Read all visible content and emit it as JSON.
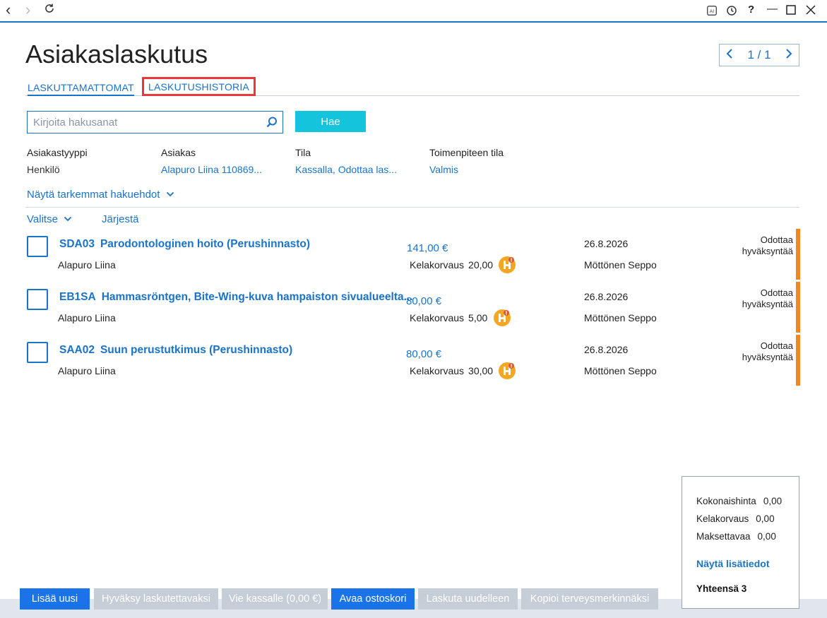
{
  "window": {
    "back_glyph": "‹",
    "forward_glyph": "›",
    "reload_glyph": "⟳",
    "icons": [
      "ai-icon",
      "history-icon",
      "help-icon",
      "minimize-icon",
      "maximize-icon",
      "close-icon"
    ],
    "help_glyph": "?",
    "minimize_glyph": "—",
    "maximize_glyph": "☐",
    "close_glyph": "✕"
  },
  "page": {
    "title": "Asiakaslaskutus",
    "pager": {
      "text": "1 / 1"
    }
  },
  "tabs": [
    {
      "label": "LASKUTTAMATTOMAT",
      "active": true
    },
    {
      "label": "LASKUTUSHISTORIA",
      "active": false,
      "highlighted": true
    }
  ],
  "search": {
    "placeholder": "Kirjoita hakusanat",
    "button_label": "Hae"
  },
  "filters": [
    {
      "label": "Asiakastyyppi",
      "value": "Henkilö",
      "is_link": false
    },
    {
      "label": "Asiakas",
      "value": "Alapuro Liina 110869...",
      "is_link": true
    },
    {
      "label": "Tila",
      "value": "Kassalla, Odottaa las...",
      "is_link": true
    },
    {
      "label": "Toimenpiteen tila",
      "value": "Valmis",
      "is_link": true
    }
  ],
  "more_filters": "Näytä tarkemmat hakuehdot",
  "list_actions": {
    "select": "Valitse",
    "sort": "Järjestä"
  },
  "rows": [
    {
      "code": "SDA03",
      "name": "Parodontologinen hoito (Perushinnasto)",
      "customer": "Alapuro Liina",
      "price": "141,00 €",
      "kela_label": "Kelakorvaus",
      "kela_value": "20,00",
      "date": "26.8.2026",
      "person": "Möttönen Seppo",
      "status_line1": "Odottaa",
      "status_line2": "hyväksyntää"
    },
    {
      "code": "EB1SA",
      "name": "Hammasröntgen, Bite-Wing-kuva hampaiston sivualueelta...",
      "customer": "Alapuro Liina",
      "price": "80,00 €",
      "kela_label": "Kelakorvaus",
      "kela_value": "5,00",
      "date": "26.8.2026",
      "person": "Möttönen Seppo",
      "status_line1": "Odottaa",
      "status_line2": "hyväksyntää"
    },
    {
      "code": "SAA02",
      "name": "Suun perustutkimus (Perushinnasto)",
      "customer": "Alapuro Liina",
      "price": "80,00 €",
      "kela_label": "Kelakorvaus",
      "kela_value": "30,00",
      "date": "26.8.2026",
      "person": "Möttönen Seppo",
      "status_line1": "Odottaa",
      "status_line2": "hyväksyntää"
    }
  ],
  "summary": {
    "total_price_label": "Kokonaishinta",
    "total_price": "0,00",
    "kela_label": "Kelakorvaus",
    "kela": "0,00",
    "payable_label": "Maksettavaa",
    "payable": "0,00",
    "details_link": "Näytä lisätiedot",
    "count_label": "Yhteensä 3"
  },
  "actions": {
    "add_new": "Lisää uusi",
    "approve": "Hyväksy laskutettavaksi",
    "to_checkout": "Vie kassalle (0,00 €)",
    "open_cart": "Avaa ostoskori",
    "rebill": "Laskuta uudelleen",
    "copy_entries": "Kopioi terveysmerkinnäksi"
  },
  "colors": {
    "accent": "#1a73c8",
    "search_button": "#14c4dc",
    "status_stripe": "#f2871e",
    "badge": "#f5a623",
    "tab_highlight": "#e8383d",
    "primary_button": "#1a73e8",
    "disabled_button": "#c5cdd7"
  }
}
